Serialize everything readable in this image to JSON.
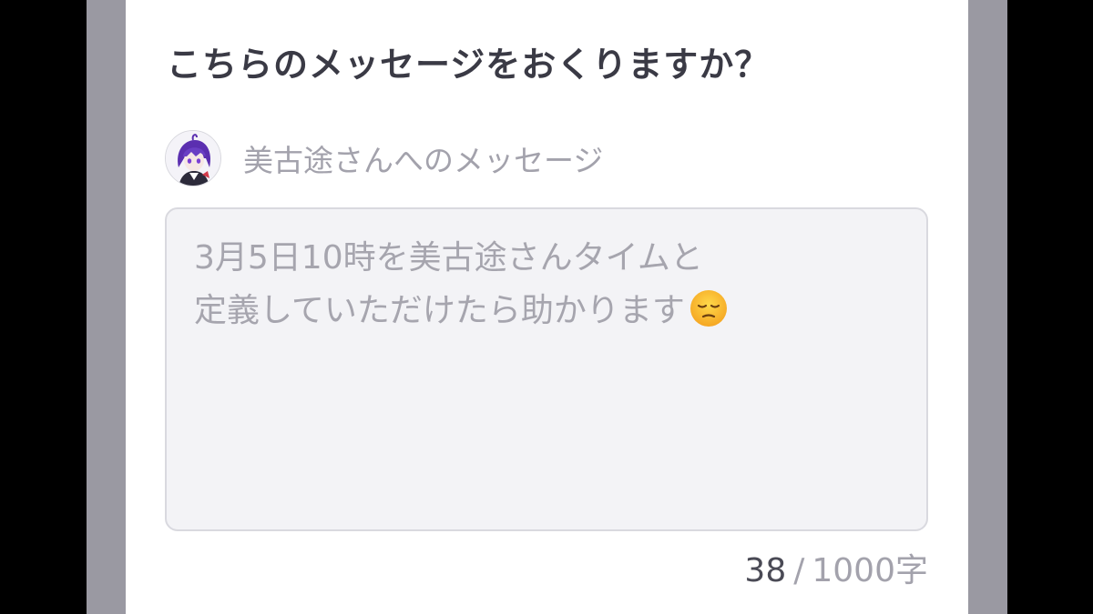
{
  "dialog": {
    "title": "こちらのメッセージをおくりますか？"
  },
  "recipient": {
    "avatar_icon": "character-avatar-icon",
    "label": "美古途さんへのメッセージ"
  },
  "message": {
    "lines": [
      "3月5日10時を美古途さんタイムと",
      "定義していただけたら助かります"
    ],
    "trailing_emoji": "pensive-face-emoji"
  },
  "counter": {
    "current": "38",
    "separator": "/",
    "limit": "1000字"
  },
  "colors": {
    "outer_background": "#000000",
    "side_frame": "#9a99a2",
    "card_background": "#ffffff",
    "title_text": "#3a3a45",
    "muted_text": "#a3a2ac",
    "input_background": "#f3f3f6",
    "input_border": "#d9d9df",
    "avatar_accent": "#6a3fc4"
  }
}
